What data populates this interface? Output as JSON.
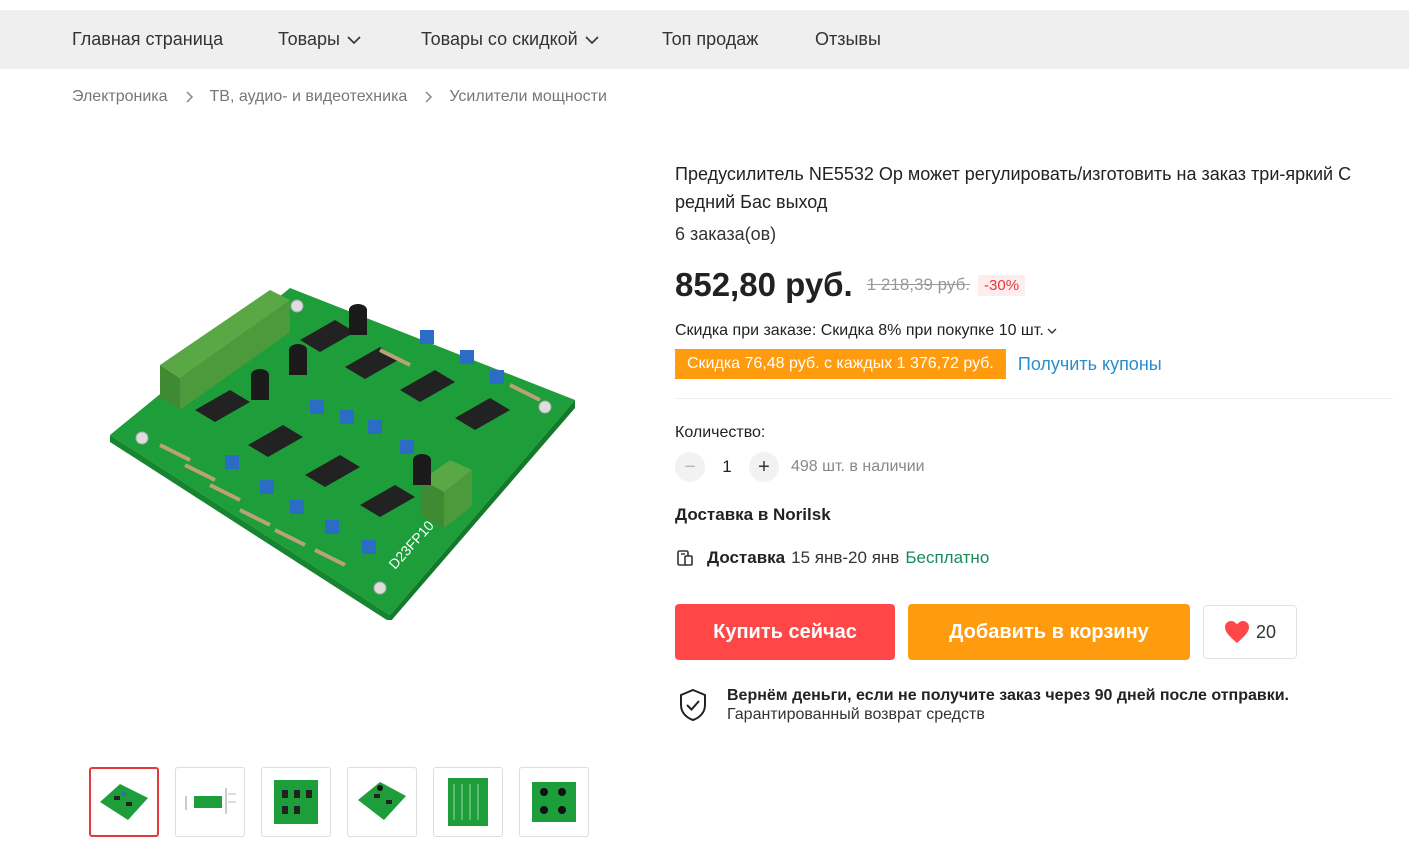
{
  "nav": {
    "items": [
      {
        "label": "Главная страница",
        "dropdown": false
      },
      {
        "label": "Товары",
        "dropdown": true
      },
      {
        "label": "Товары со скидкой",
        "dropdown": true
      },
      {
        "label": "Топ продаж",
        "dropdown": false
      },
      {
        "label": "Отзывы",
        "dropdown": false
      }
    ]
  },
  "breadcrumb": [
    "Электроника",
    "ТВ, аудио- и видеотехника",
    "Усилители мощности"
  ],
  "product": {
    "title": "Предусилитель NE5532 Op может регулировать/изготовить на заказ три-яркий С редний Бас выход",
    "orders": "6 заказа(ов)",
    "price": "852,80 руб.",
    "old_price": "1 218,39 руб.",
    "discount": "-30%",
    "board_label": "D23FP10",
    "order_discount": "Скидка при заказе: Скидка 8% при покупке 10 шт.",
    "coupon": "Скидка 76,48 руб. с каждых 1 376,72 руб.",
    "coupon_link": "Получить купоны",
    "quantity_label": "Количество:",
    "quantity_value": "1",
    "stock": "498 шт. в наличии",
    "delivery_to": "Доставка в Norilsk",
    "delivery_label": "Доставка",
    "delivery_dates": "15 янв-20 янв",
    "delivery_price": "Бесплатно",
    "buy_now": "Купить сейчас",
    "add_to_cart": "Добавить в корзину",
    "wishlist_count": "20",
    "guarantee_title": "Вернём деньги, если не получите заказ через 90 дней после отправки.",
    "guarantee_sub": "Гарантированный возврат средств"
  },
  "thumbnails": [
    {
      "name": "pcb-angled",
      "active": true
    },
    {
      "name": "pcb-dimensions",
      "active": false
    },
    {
      "name": "pcb-top",
      "active": false
    },
    {
      "name": "pcb-angled-2",
      "active": false
    },
    {
      "name": "pcb-bottom",
      "active": false
    },
    {
      "name": "pcb-top-2",
      "active": false
    }
  ],
  "colors": {
    "accent_red": "#ff4747",
    "accent_orange": "#ff9b0f",
    "link_blue": "#2a8dce",
    "free_green": "#1a8a5a",
    "pcb_green": "#1e9e3a"
  }
}
